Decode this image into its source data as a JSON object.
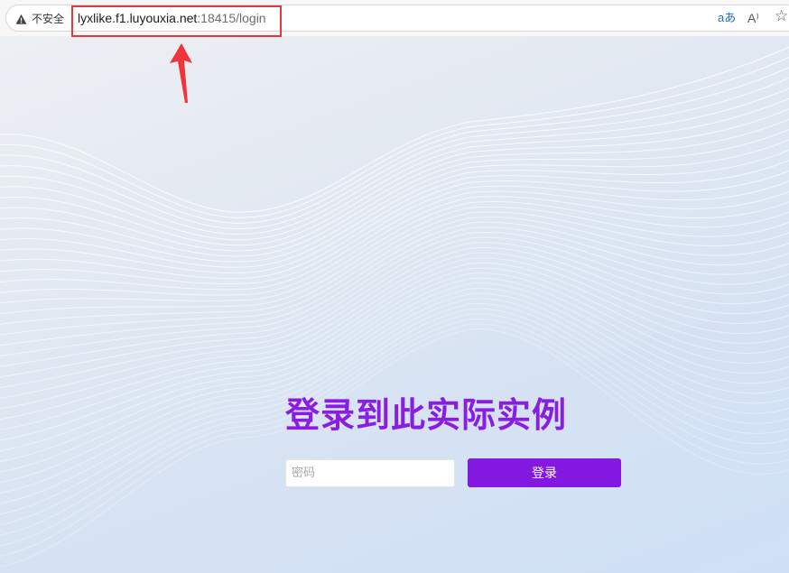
{
  "browser": {
    "security_label": "不安全",
    "url_host": "lyxlike.f1.luyouxia.net",
    "url_rest": ":18415/login",
    "translate_icon_text": "aあ",
    "read_aloud_icon_text": "A⁾",
    "favorite_icon_text": "☆"
  },
  "annotation": {
    "highlight_color": "#e8363b"
  },
  "login": {
    "title": "登录到此实际实例",
    "password_placeholder": "密码",
    "submit_label": "登录"
  },
  "colors": {
    "accent": "#8318e0",
    "title": "#8a1ee0"
  }
}
